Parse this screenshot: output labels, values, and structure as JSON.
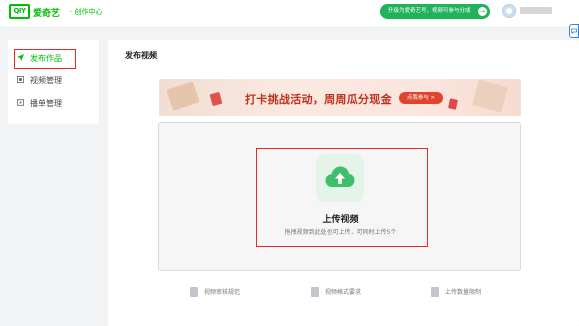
{
  "header": {
    "logo_text": "QIY",
    "brand": "爱奇艺",
    "subtitle": "· 创作中心",
    "promo_text": "升级为爱奇艺号，视频可参与分成",
    "promo_arrow": "→",
    "side_widget_icon": "chat-icon"
  },
  "sidebar": {
    "items": [
      {
        "label": "发布作品",
        "icon": "send-icon",
        "active": true
      },
      {
        "label": "视频管理",
        "icon": "video-grid-icon"
      },
      {
        "label": "播单管理",
        "icon": "playlist-icon"
      }
    ]
  },
  "main": {
    "title": "发布视频",
    "banner": {
      "text": "打卡挑战活动，周周瓜分现金",
      "button": "点我参与 >"
    },
    "upload": {
      "icon": "cloud-upload-icon",
      "title": "上传视频",
      "subtitle": "拖拽视频到此处也可上传，可同时上传5个"
    },
    "footer_links": [
      {
        "label": "视频审核规范",
        "icon": "document-icon"
      },
      {
        "label": "视频格式要求",
        "icon": "video-file-icon"
      },
      {
        "label": "上传数量限制",
        "icon": "document-icon"
      }
    ]
  },
  "colors": {
    "brand_green": "#00be06",
    "promo_green": "#21b35b",
    "highlight_red": "#e52a2a",
    "banner_red": "#c0301c"
  }
}
